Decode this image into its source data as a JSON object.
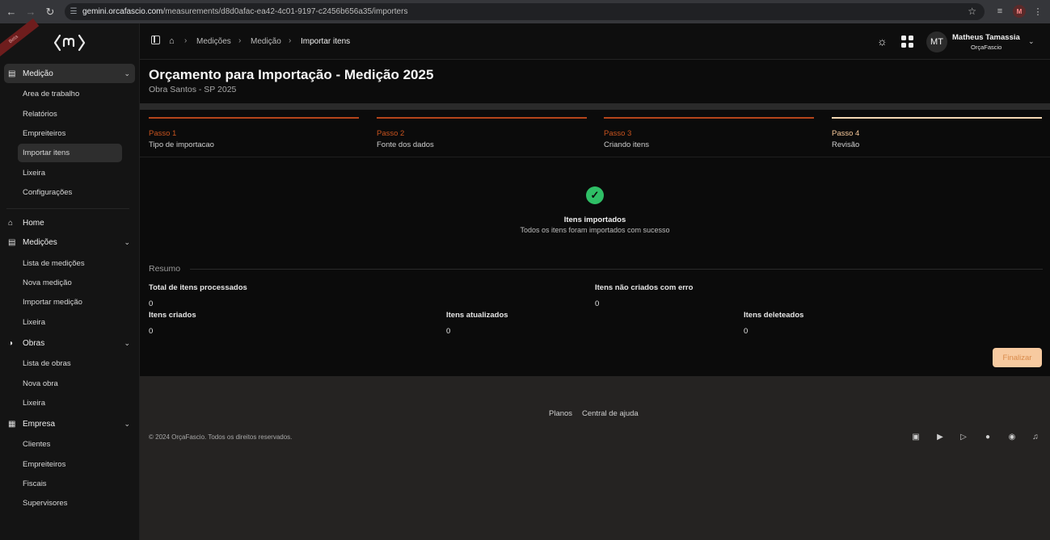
{
  "browser": {
    "url_host": "gemini.orcafascio.com",
    "url_path": "/measurements/d8d0afac-ea42-4c01-9197-c2456b656a35/importers",
    "profile_initial": "M"
  },
  "sidebar": {
    "ribbon": "Beta",
    "groups": [
      {
        "label": "Medição",
        "icon": "document-icon",
        "items": [
          "Area de trabalho",
          "Relatórios",
          "Empreiteiros",
          "Importar itens",
          "Lixeira",
          "Configurações"
        ]
      },
      {
        "label": "Home",
        "icon": "home-icon"
      },
      {
        "label": "Medições",
        "icon": "document-icon",
        "items": [
          "Lista de medições",
          "Nova medição",
          "Importar medição",
          "Lixeira"
        ]
      },
      {
        "label": "Obras",
        "icon": "helmet-icon",
        "items": [
          "Lista de obras",
          "Nova obra",
          "Lixeira"
        ]
      },
      {
        "label": "Empresa",
        "icon": "building-icon",
        "items": [
          "Clientes",
          "Empreiteiros",
          "Fiscais",
          "Supervisores"
        ]
      }
    ]
  },
  "topbar": {
    "breadcrumbs": [
      "Medições",
      "Medição",
      "Importar itens"
    ],
    "user": {
      "initials": "MT",
      "name": "Matheus Tamassia",
      "org": "OrçaFascio"
    }
  },
  "page": {
    "title": "Orçamento para Importação - Medição 2025",
    "subtitle": "Obra Santos - SP 2025"
  },
  "steps": [
    {
      "num": "Passo 1",
      "label": "Tipo de importacao"
    },
    {
      "num": "Passo 2",
      "label": "Fonte dos dados"
    },
    {
      "num": "Passo 3",
      "label": "Criando itens"
    },
    {
      "num": "Passo 4",
      "label": "Revisão"
    }
  ],
  "result": {
    "title": "Itens importados",
    "description": "Todos os itens foram importados com sucesso"
  },
  "summary": {
    "label": "Resumo",
    "total_processed": {
      "label": "Total de itens processados",
      "value": "0"
    },
    "not_created_error": {
      "label": "Itens não criados com erro",
      "value": "0"
    },
    "created": {
      "label": "Itens criados",
      "value": "0"
    },
    "updated": {
      "label": "Itens atualizados",
      "value": "0"
    },
    "deleted": {
      "label": "Itens deleteados",
      "value": "0"
    }
  },
  "actions": {
    "finalize": "Finalizar"
  },
  "footer": {
    "links": [
      "Planos",
      "Central de ajuda"
    ],
    "copyright": "© 2024 OrçaFascio. Todos os direitos reservados."
  },
  "colors": {
    "accent": "#b5451b",
    "step_current": "#f5d9b5",
    "success": "#2fbf66",
    "button_bg": "#f7caa0"
  }
}
